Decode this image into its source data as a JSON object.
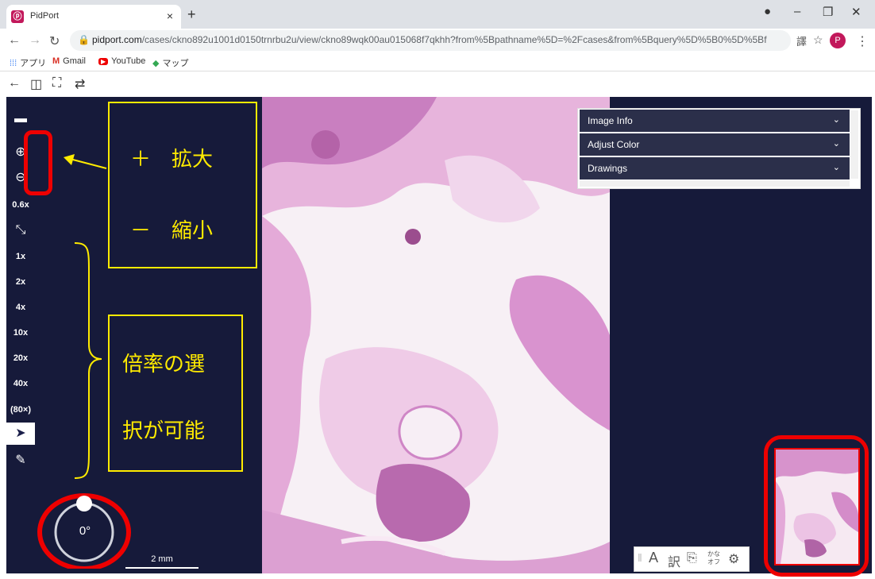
{
  "browser": {
    "tab_title": "PidPort",
    "tab_close": "×",
    "new_tab": "+",
    "url_host": "pidport.com",
    "url_path": "/cases/ckno892u1001d0150trnrbu2u/view/ckno89wqk00au015068f7qkhh?from%5Bpathname%5D=%2Fcases&from%5Bquery%5D%5B0%5D%5Bfield%5D=orga...",
    "profile_initial": "P",
    "bookmarks": [
      "アプリ",
      "Gmail",
      "YouTube",
      "マップ"
    ]
  },
  "panels": [
    {
      "label": "Image Info"
    },
    {
      "label": "Adjust Color"
    },
    {
      "label": "Drawings"
    }
  ],
  "sidebar": {
    "zoom_level": "0.6x",
    "magnifications": [
      "1x",
      "2x",
      "4x",
      "10x",
      "20x",
      "40x",
      "(80×)"
    ]
  },
  "annotations": {
    "zoom_in": "＋　拡大",
    "zoom_out": "－　縮小",
    "magnification_line1": "倍率の選",
    "magnification_line2": "択が可能"
  },
  "rotation": {
    "value": "0°"
  },
  "scale_bar": {
    "label": "2 mm"
  },
  "bottom_tools": {
    "text_a": "A",
    "kana": "かな\nオフ"
  },
  "colors": {
    "viewer_bg": "#161a3a",
    "annotation_yellow": "#ffeb00",
    "highlight_red": "#e00000",
    "tissue_pink": "#e3a6d6"
  }
}
